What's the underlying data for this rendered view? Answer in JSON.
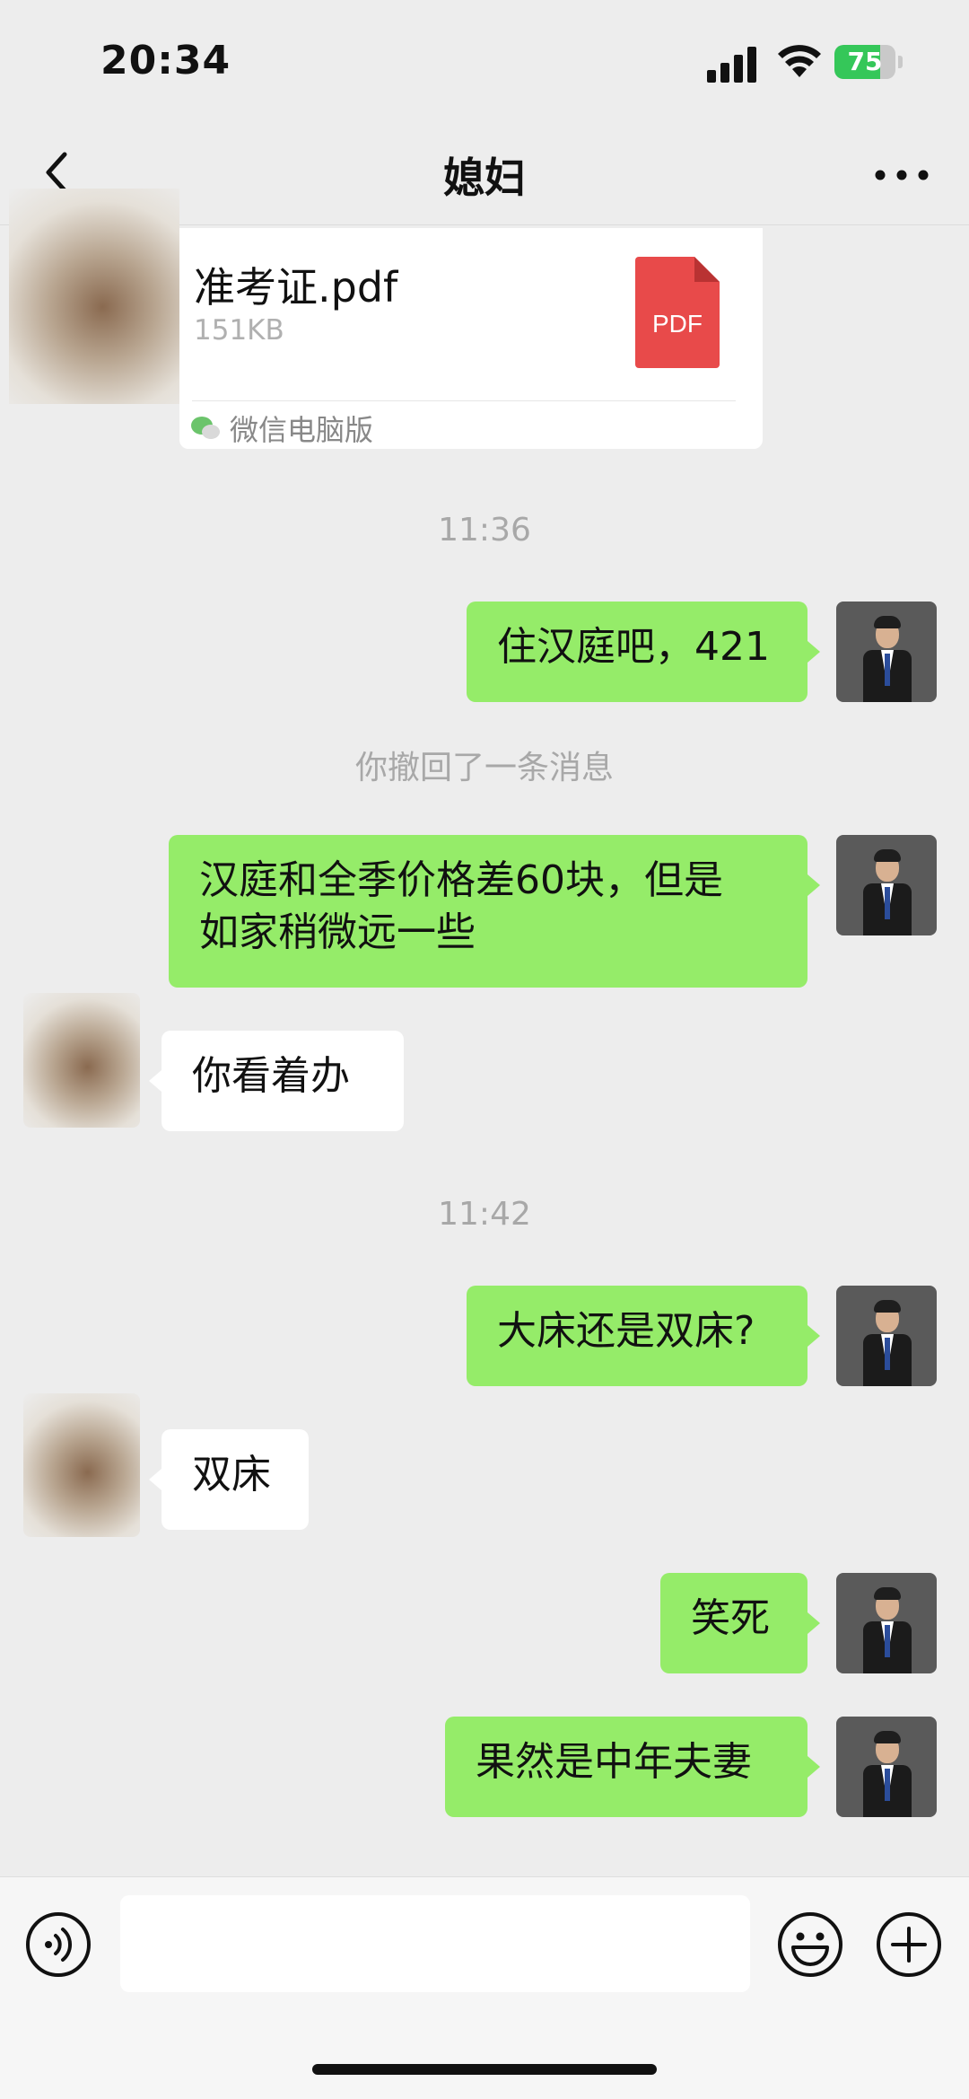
{
  "status": {
    "time": "20:34",
    "battery": "75",
    "battery_level_percent": 75
  },
  "nav": {
    "title": "媳妇"
  },
  "file": {
    "name": "准考证.pdf",
    "size": "151KB",
    "type_badge": "PDF",
    "source": "微信电脑版"
  },
  "messages": {
    "time1": "11:36",
    "m1": "住汉庭吧，421",
    "recalled": "你撤回了一条消息",
    "m2_line1": "汉庭和全季价格差60块，但是",
    "m2_line2": "如家稍微远一些",
    "m3": "你看着办",
    "time2": "11:42",
    "m4": "大床还是双床?",
    "m5": "双床",
    "m6": "笑死",
    "m7": "果然是中年夫妻"
  },
  "colors": {
    "my_bubble": "#95ec69",
    "their_bubble": "#ffffff",
    "background": "#ededed",
    "pdf_red": "#e84a4a",
    "battery_green": "#35c759"
  },
  "icons": [
    "back-chevron-icon",
    "more-dots-icon",
    "pdf-file-icon",
    "wechat-icon",
    "voice-icon",
    "emoji-icon",
    "plus-icon",
    "signal-icon",
    "wifi-icon",
    "battery-icon"
  ]
}
